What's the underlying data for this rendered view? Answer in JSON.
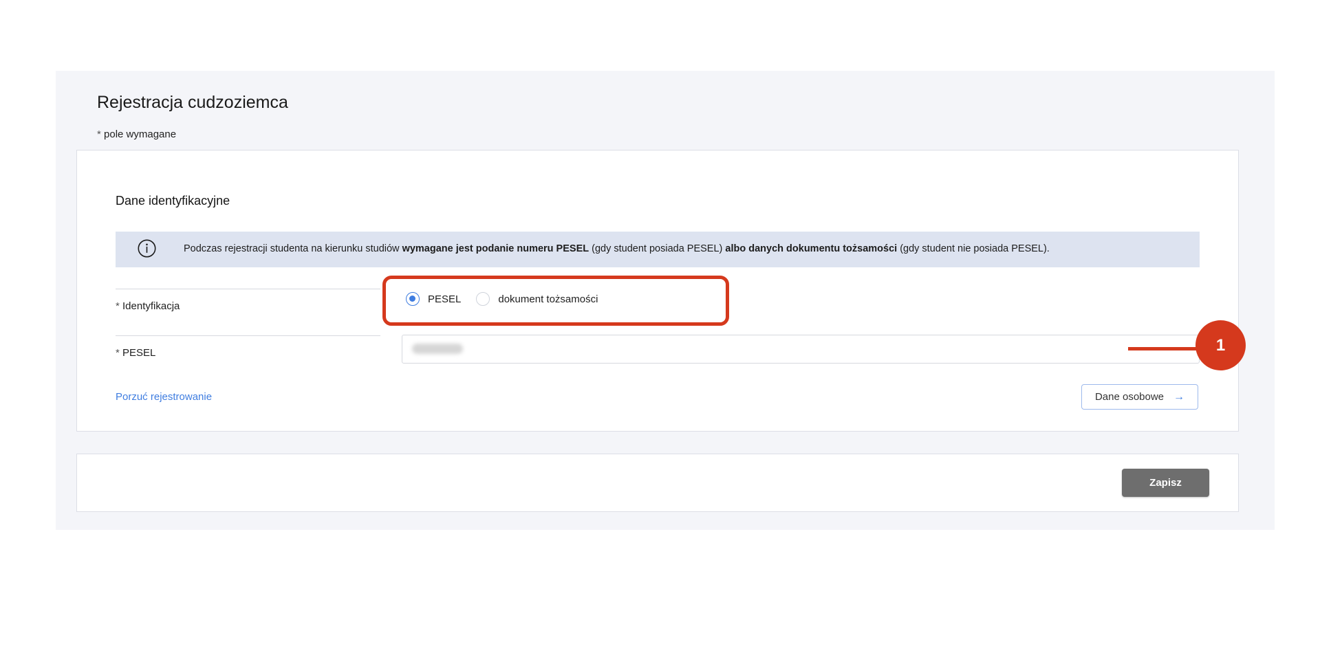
{
  "page": {
    "title": "Rejestracja cudzoziemca",
    "required_asterisk": "*",
    "required_note": "pole wymagane"
  },
  "section": {
    "title": "Dane identyfikacyjne"
  },
  "info": {
    "icon": "info-circle-icon",
    "text_1": "Podczas rejestracji studenta na kierunku studiów ",
    "bold_1": "wymagane jest podanie numeru PESEL",
    "text_2": " (gdy student posiada PESEL) ",
    "bold_2": "albo danych dokumentu tożsamości",
    "text_3": " (gdy student nie posiada PESEL)."
  },
  "identification": {
    "asterisk": "*",
    "label": "Identyfikacja",
    "options": [
      {
        "label": "PESEL",
        "checked": true
      },
      {
        "label": "dokument tożsamości",
        "checked": false
      }
    ]
  },
  "pesel": {
    "asterisk": "*",
    "label": "PESEL",
    "value_blurred": true
  },
  "annotation": {
    "number": "1",
    "color": "#d5391d"
  },
  "actions": {
    "abandon_link": "Porzuć rejestrowanie",
    "next_label": "Dane osobowe",
    "next_icon": "arrow-right-icon",
    "save_label": "Zapisz"
  },
  "colors": {
    "accent": "#3f7de0",
    "info_bg": "#dde3f0",
    "save_bg": "#6e6e6e"
  }
}
